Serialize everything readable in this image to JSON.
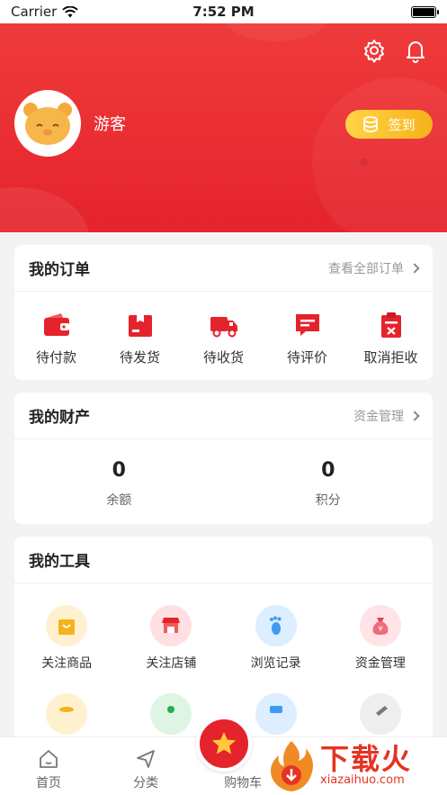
{
  "status": {
    "carrier": "Carrier",
    "time": "7:52 PM"
  },
  "header": {
    "username": "游客",
    "signin_label": "签到"
  },
  "orders": {
    "title": "我的订单",
    "link": "查看全部订单",
    "items": [
      {
        "label": "待付款",
        "icon": "wallet-icon"
      },
      {
        "label": "待发货",
        "icon": "box-icon"
      },
      {
        "label": "待收货",
        "icon": "truck-icon"
      },
      {
        "label": "待评价",
        "icon": "comment-icon"
      },
      {
        "label": "取消拒收",
        "icon": "cancel-icon"
      }
    ]
  },
  "assets": {
    "title": "我的财产",
    "link": "资金管理",
    "items": [
      {
        "value": "0",
        "label": "余额"
      },
      {
        "value": "0",
        "label": "积分"
      }
    ]
  },
  "tools": {
    "title": "我的工具",
    "items": [
      {
        "label": "关注商品",
        "icon": "shopping-bag-icon"
      },
      {
        "label": "关注店铺",
        "icon": "store-icon"
      },
      {
        "label": "浏览记录",
        "icon": "footprint-icon"
      },
      {
        "label": "资金管理",
        "icon": "money-bag-icon"
      }
    ]
  },
  "tabs": [
    {
      "label": "首页",
      "icon": "home-icon"
    },
    {
      "label": "分类",
      "icon": "category-icon"
    },
    {
      "label": "购物车",
      "icon": "star-icon"
    }
  ],
  "watermark": {
    "big": "下载火",
    "small": "xiazaihuo.com"
  },
  "colors": {
    "primary": "#e5232d",
    "gold": "#f6b21b"
  }
}
